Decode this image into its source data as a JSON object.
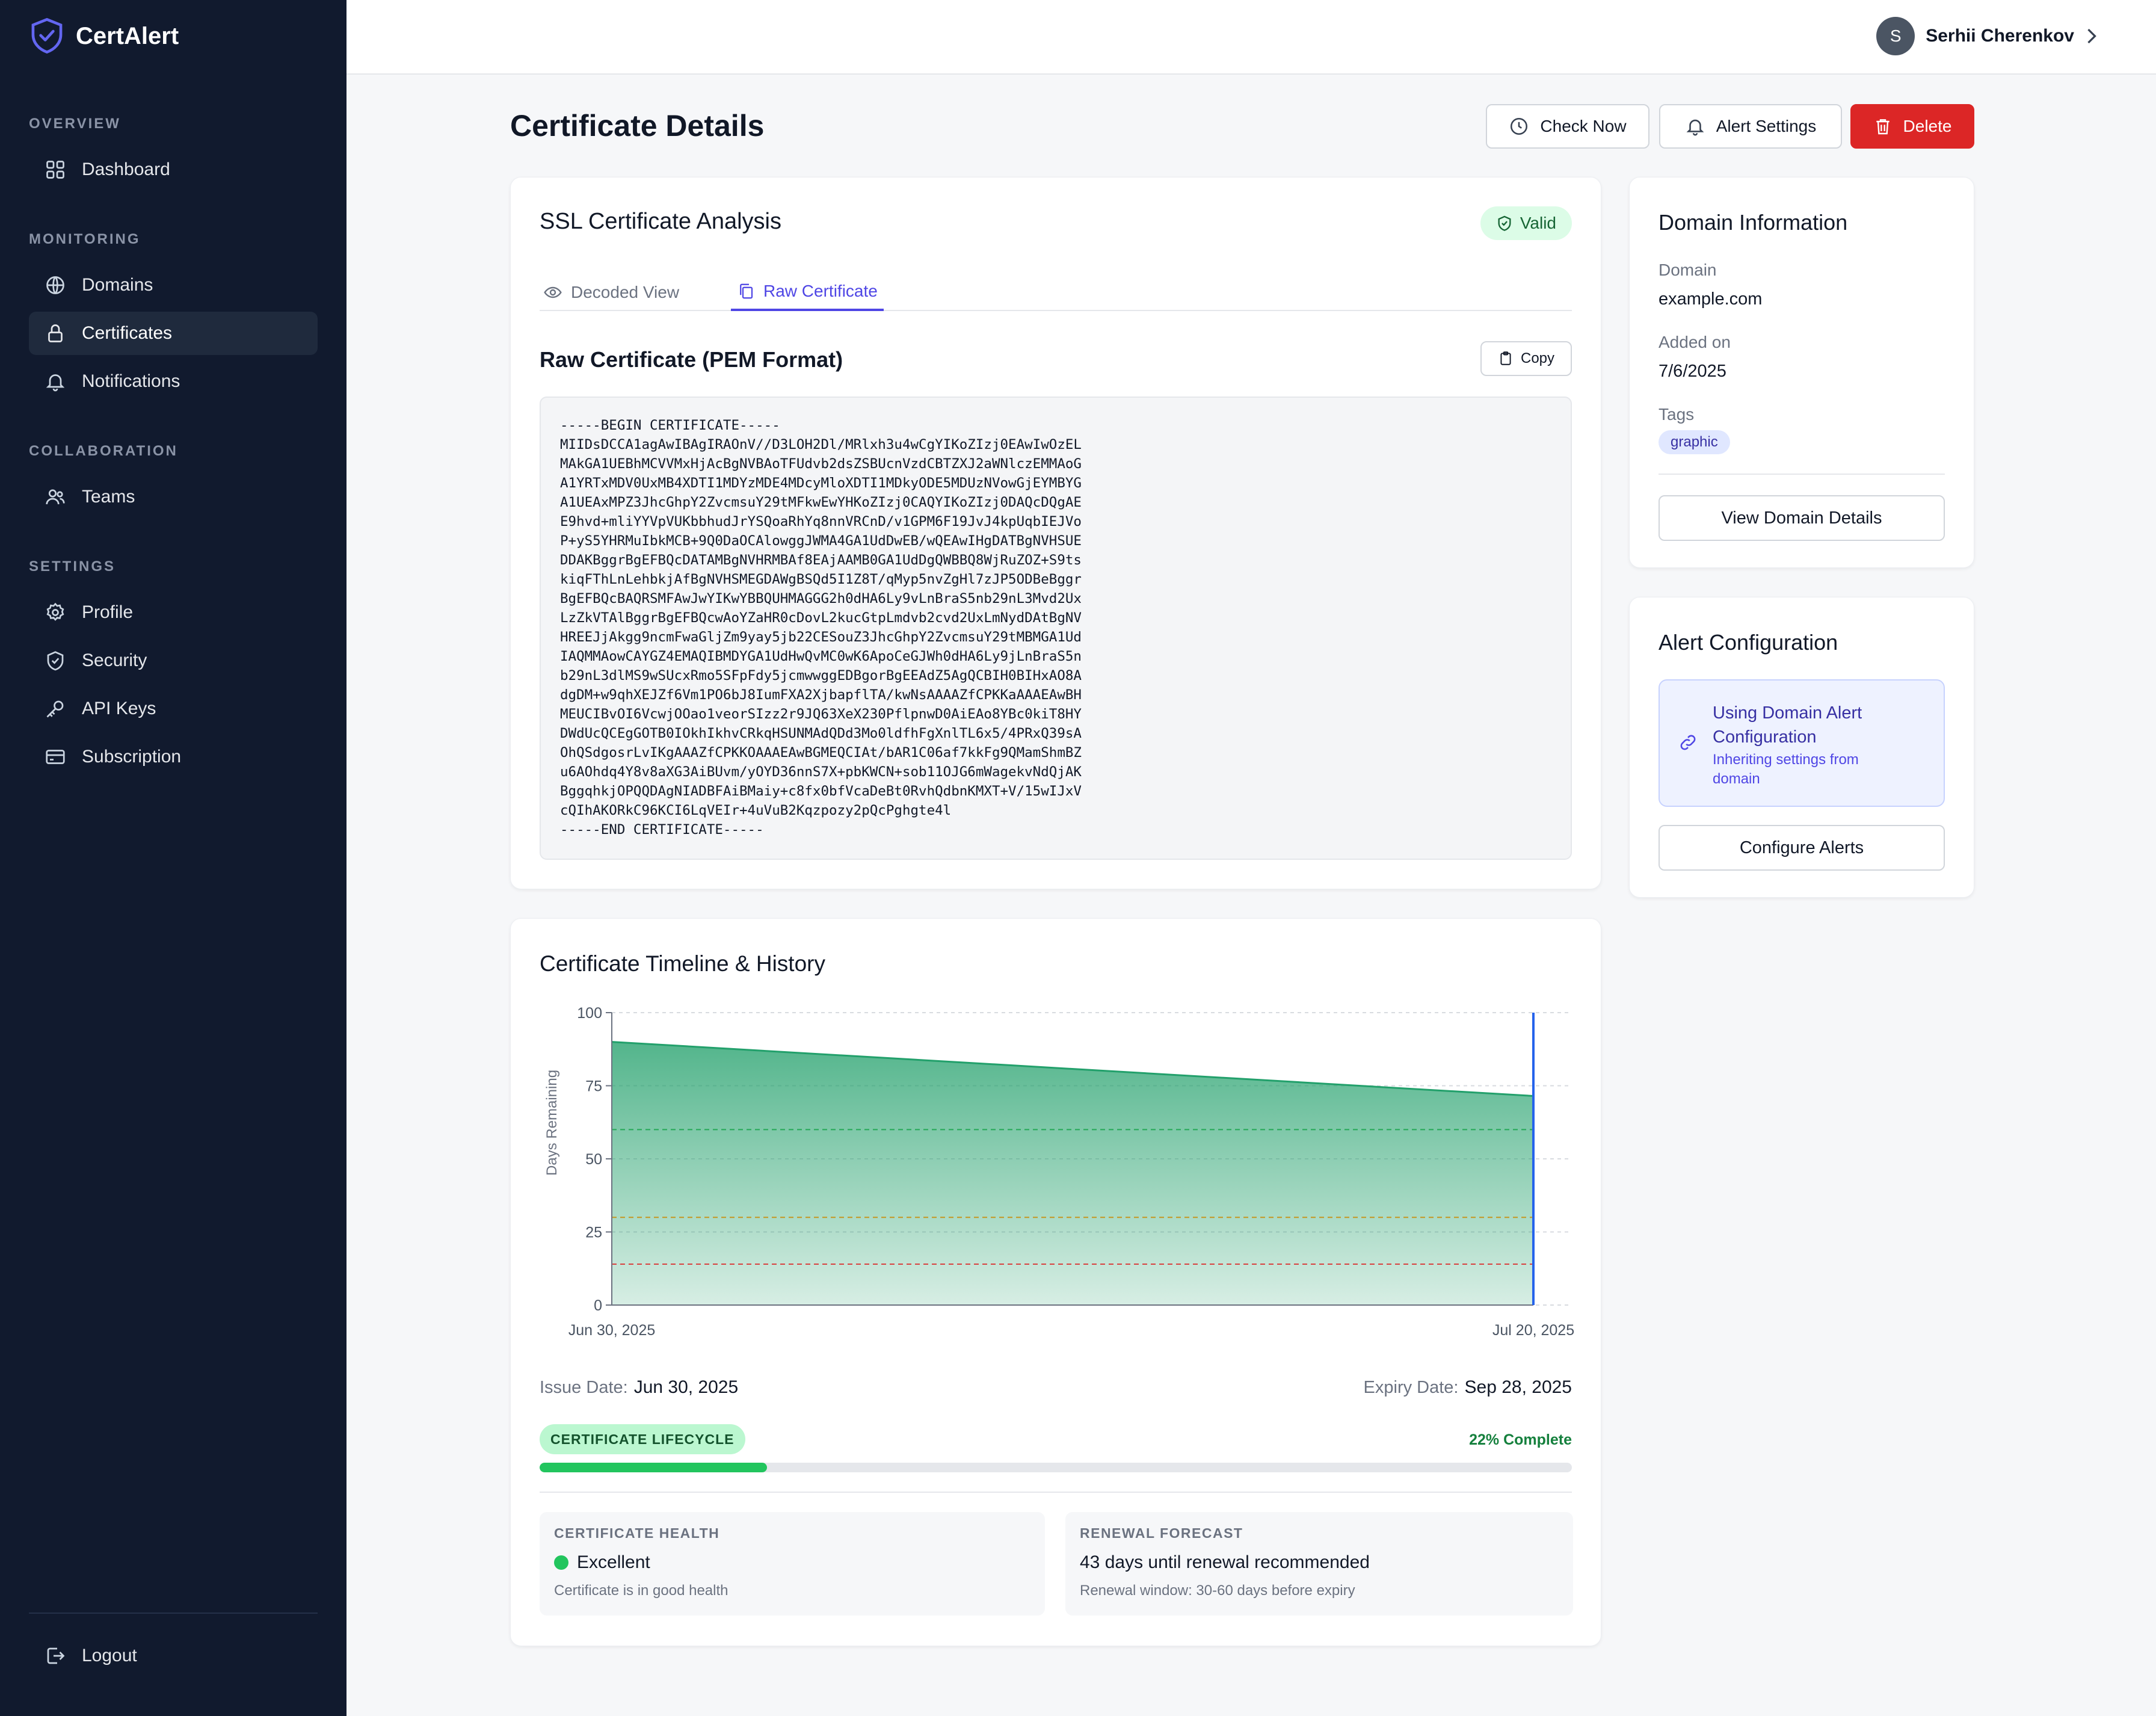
{
  "app": {
    "name": "CertAlert"
  },
  "sidebar": {
    "sections": [
      {
        "label": "OVERVIEW"
      },
      {
        "label": "MONITORING"
      },
      {
        "label": "COLLABORATION"
      },
      {
        "label": "SETTINGS"
      }
    ],
    "items": [
      {
        "label": "Dashboard",
        "icon": "grid-icon"
      },
      {
        "label": "Domains",
        "icon": "globe-icon"
      },
      {
        "label": "Certificates",
        "icon": "lock-icon",
        "active": true
      },
      {
        "label": "Notifications",
        "icon": "bell-icon"
      },
      {
        "label": "Teams",
        "icon": "users-icon"
      },
      {
        "label": "Profile",
        "icon": "gear-icon"
      },
      {
        "label": "Security",
        "icon": "shield-icon"
      },
      {
        "label": "API Keys",
        "icon": "key-icon"
      },
      {
        "label": "Subscription",
        "icon": "card-icon"
      }
    ],
    "logout": "Logout"
  },
  "user": {
    "initial": "S",
    "name": "Serhii Cherenkov"
  },
  "page": {
    "title": "Certificate Details",
    "actions": {
      "check_now": "Check Now",
      "alert_settings": "Alert Settings",
      "delete": "Delete"
    }
  },
  "ssl": {
    "title": "SSL Certificate Analysis",
    "status": "Valid",
    "tabs": [
      {
        "label": "Decoded View"
      },
      {
        "label": "Raw Certificate",
        "active": true
      }
    ],
    "raw_title": "Raw Certificate (PEM Format)",
    "copy_label": "Copy",
    "pem": "-----BEGIN CERTIFICATE-----\nMIIDsDCCA1agAwIBAgIRAOnV//D3LOH2Dl/MRlxh3u4wCgYIKoZIzj0EAwIwOzEL\nMAkGA1UEBhMCVVMxHjAcBgNVBAoTFUdvb2dsZSBUcnVzdCBTZXJ2aWNlczEMMAoG\nA1YRTxMDV0UxMB4XDTI1MDYzMDE4MDcyMloXDTI1MDkyODE5MDUzNVowGjEYMBYG\nA1UEAxMPZ3JhcGhpY2ZvcmsuY29tMFkwEwYHKoZIzj0CAQYIKoZIzj0DAQcDQgAE\nE9hvd+mliYYVpVUKbbhudJrYSQoaRhYq8nnVRCnD/v1GPM6F19JvJ4kpUqbIEJVo\nP+yS5YHRMuIbkMCB+9Q0DaOCAlowggJWMA4GA1UdDwEB/wQEAwIHgDATBgNVHSUE\nDDAKBggrBgEFBQcDATAMBgNVHRMBAf8EAjAAMB0GA1UdDgQWBBQ8WjRuZOZ+S9ts\nkiqFThLnLehbkjAfBgNVHSMEGDAWgBSQd5I1Z8T/qMyp5nvZgHl7zJP5ODBeBggr\nBgEFBQcBAQRSMFAwJwYIKwYBBQUHMAGGG2h0dHA6Ly9vLnBraS5nb29nL3Mvd2Ux\nLzZkVTAlBggrBgEFBQcwAoYZaHR0cDovL2kucGtpLmdvb2cvd2UxLmNydDAtBgNV\nHREEJjAkgg9ncmFwaGljZm9yay5jb22CESouZ3JhcGhpY2ZvcmsuY29tMBMGA1Ud\nIAQMMAowCAYGZ4EMAQIBMDYGA1UdHwQvMC0wK6ApoCeGJWh0dHA6Ly9jLnBraS5n\nb29nL3dlMS9wSUcxRmo5SFpFdy5jcmwwggEDBgorBgEEAdZ5AgQCBIH0BIHxAO8A\ndgDM+w9qhXEJZf6Vm1PO6bJ8IumFXA2XjbapflTA/kwNsAAAAZfCPKKaAAAEAwBH\nMEUCIBvOI6VcwjOOao1veorSIzz2r9JQ63XeX230PflpnwD0AiEAo8YBc0kiT8HY\nDWdUcQCEgGOTB0IOkhIkhvCRkqHSUNMAdQDd3Mo0ldfhFgXnlTL6x5/4PRxQ39sA\nOhQSdgosrLvIKgAAAZfCPKKOAAAEAwBGMEQCIAt/bAR1C06af7kkFg9QMamShmBZ\nu6AOhdq4Y8v8aXG3AiBUvm/yOYD36nnS7X+pbKWCN+sob11OJG6mWagekvNdQjAK\nBggqhkjOPQQDAgNIADBFAiBMaiy+c8fx0bfVcaDeBt0RvhQdbnKMXT+V/15wIJxV\ncQIhAKORkC96KCI6LqVEIr+4uVuB2Kqzpozy2pQcPghgte4l\n-----END CERTIFICATE-----"
  },
  "timeline": {
    "title": "Certificate Timeline & History",
    "issue_label": "Issue Date:",
    "issue_date": "Jun 30, 2025",
    "expiry_label": "Expiry Date:",
    "expiry_date": "Sep 28, 2025",
    "lifecycle_label": "CERTIFICATE LIFECYCLE",
    "progress_pct": 22,
    "progress_text": "22% Complete",
    "health": {
      "heading": "CERTIFICATE HEALTH",
      "status": "Excellent",
      "status_color": "#22c55e",
      "sub": "Certificate is in good health"
    },
    "renewal": {
      "heading": "RENEWAL FORECAST",
      "main": "43 days until renewal recommended",
      "sub": "Renewal window: 30-60 days before expiry"
    }
  },
  "chart_data": {
    "type": "area",
    "title": "",
    "xlabel": "",
    "ylabel": "Days Remaining",
    "x": [
      "Jun 30, 2025",
      "Jul 20, 2025"
    ],
    "values": [
      90,
      71.5
    ],
    "ylim": [
      0,
      100
    ],
    "yticks": [
      0,
      25,
      50,
      75,
      100
    ],
    "xtick_labels": [
      "Jun 30, 2025",
      "Jul 20, 2025"
    ],
    "threshold_lines": [
      {
        "value": 60,
        "color": "#16a34a"
      },
      {
        "value": 30,
        "color": "#ca8a04"
      },
      {
        "value": 14,
        "color": "#dc2626"
      }
    ],
    "current_marker_color": "#2563eb",
    "fill_color": "#22a06b",
    "grid": true
  },
  "domain_info": {
    "title": "Domain Information",
    "domain_label": "Domain",
    "domain": "example.com",
    "added_label": "Added on",
    "added": "7/6/2025",
    "tags_label": "Tags",
    "tag": "graphic",
    "view_btn": "View Domain Details"
  },
  "alert_config": {
    "title": "Alert Configuration",
    "box_title": "Using Domain Alert Configuration",
    "box_sub": "Inheriting settings from domain",
    "configure_btn": "Configure Alerts"
  }
}
